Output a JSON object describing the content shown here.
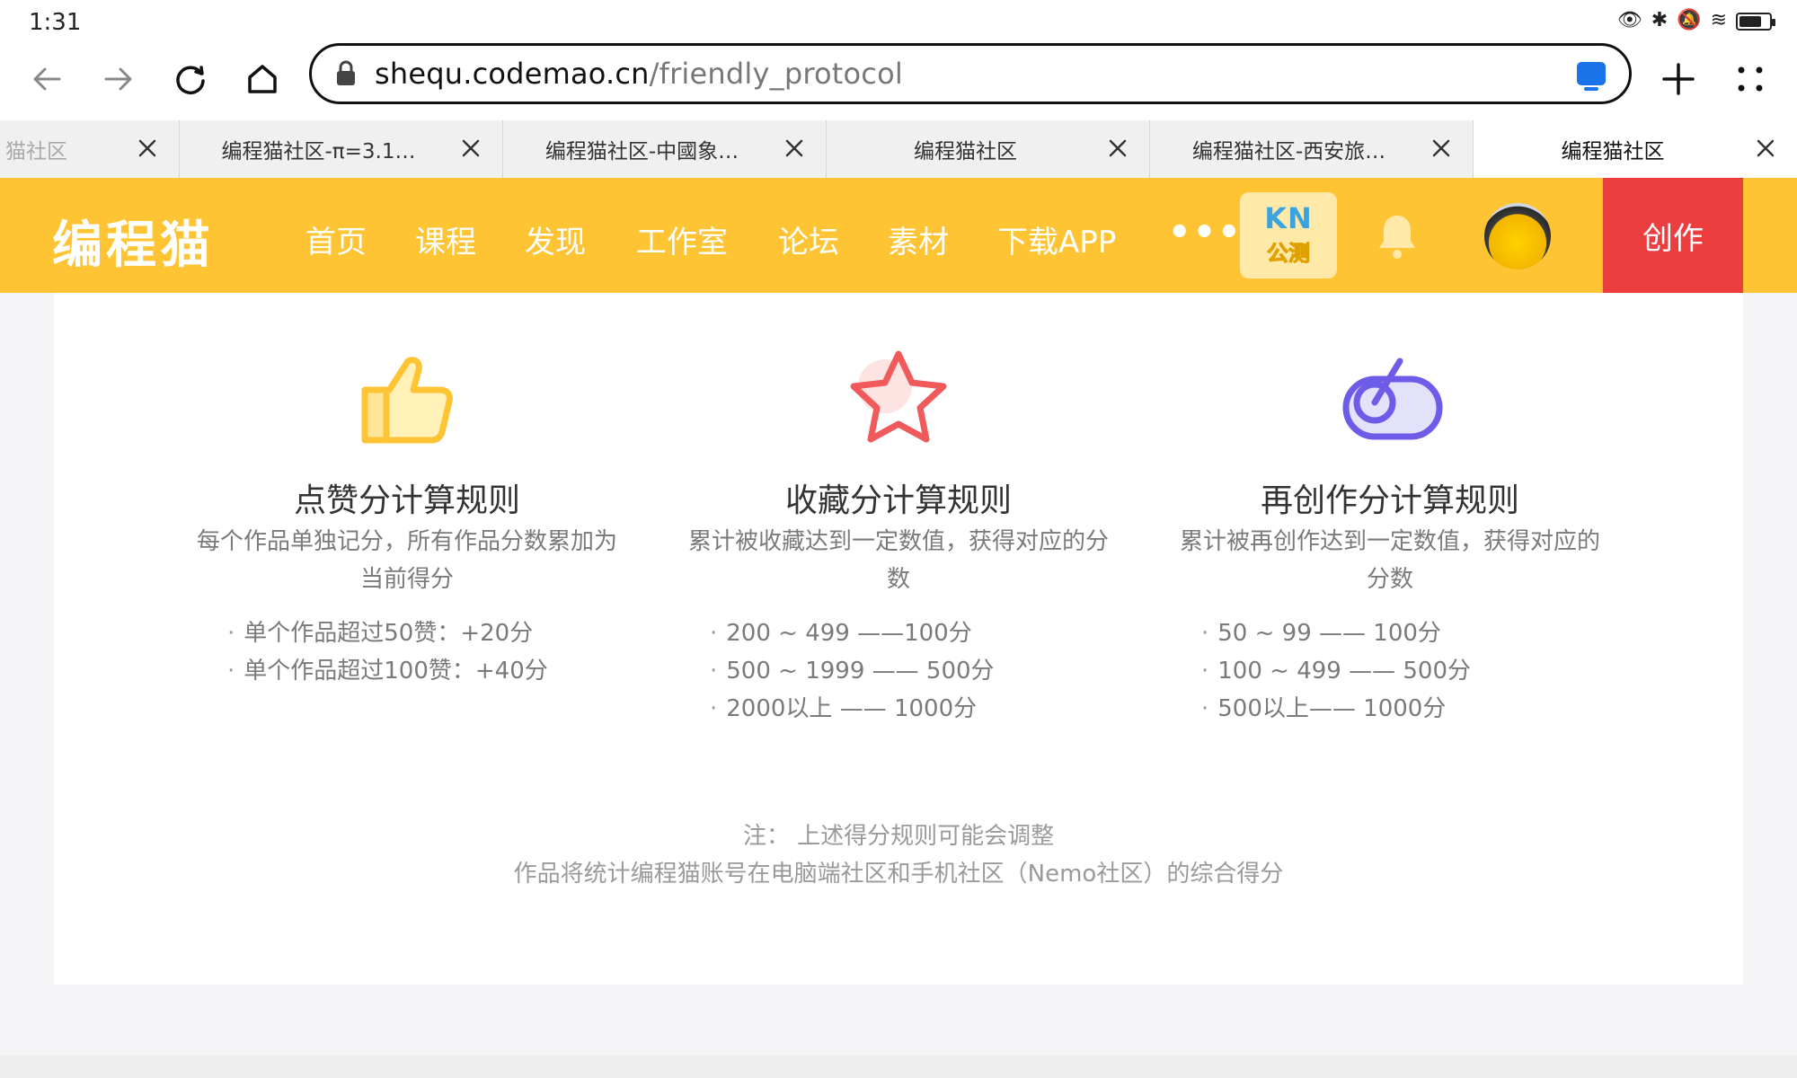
{
  "status_bar": {
    "time": "1:31",
    "battery_level": 0.75
  },
  "browser": {
    "url_host": "shequ.codemao.cn",
    "url_path": "/friendly_protocol"
  },
  "tabs": [
    {
      "label": "猫社区",
      "active": false
    },
    {
      "label": "编程猫社区-π=3.1…",
      "active": false
    },
    {
      "label": "编程猫社区-中國象…",
      "active": false
    },
    {
      "label": "编程猫社区",
      "active": false
    },
    {
      "label": "编程猫社区-西安旅…",
      "active": false
    },
    {
      "label": "编程猫社区",
      "active": true
    }
  ],
  "site_nav": {
    "logo": "编程猫",
    "items": [
      "首页",
      "课程",
      "发现",
      "工作室",
      "论坛",
      "素材",
      "下载APP"
    ],
    "more": "•••",
    "badge_top": "KN",
    "badge_bottom": "公测",
    "create_label": "创作"
  },
  "colors": {
    "brand_yellow": "#fec433",
    "create_red": "#ec3e3e",
    "kn_blue": "#3aa3e0"
  },
  "rules": [
    {
      "icon": "thumbs-up-icon",
      "title": "点赞分计算规则",
      "desc": "每个作品单独记分，所有作品分数累加为当前得分",
      "items": [
        "单个作品超过50赞：+20分",
        "单个作品超过100赞：+40分"
      ]
    },
    {
      "icon": "star-icon",
      "title": "收藏分计算规则",
      "desc": "累计被收藏达到一定数值，获得对应的分数",
      "items": [
        "200 ~ 499 ——100分",
        "500 ~ 1999 —— 500分",
        "2000以上 —— 1000分"
      ]
    },
    {
      "icon": "recreate-icon",
      "title": "再创作分计算规则",
      "desc": "累计被再创作达到一定数值，获得对应的分数",
      "items": [
        "50 ~ 99 —— 100分",
        "100 ~ 499 —— 500分",
        "500以上—— 1000分"
      ]
    }
  ],
  "notes": {
    "line1": "注：  上述得分规则可能会调整",
    "line2": "作品将统计编程猫账号在电脑端社区和手机社区（Nemo社区）的综合得分"
  }
}
